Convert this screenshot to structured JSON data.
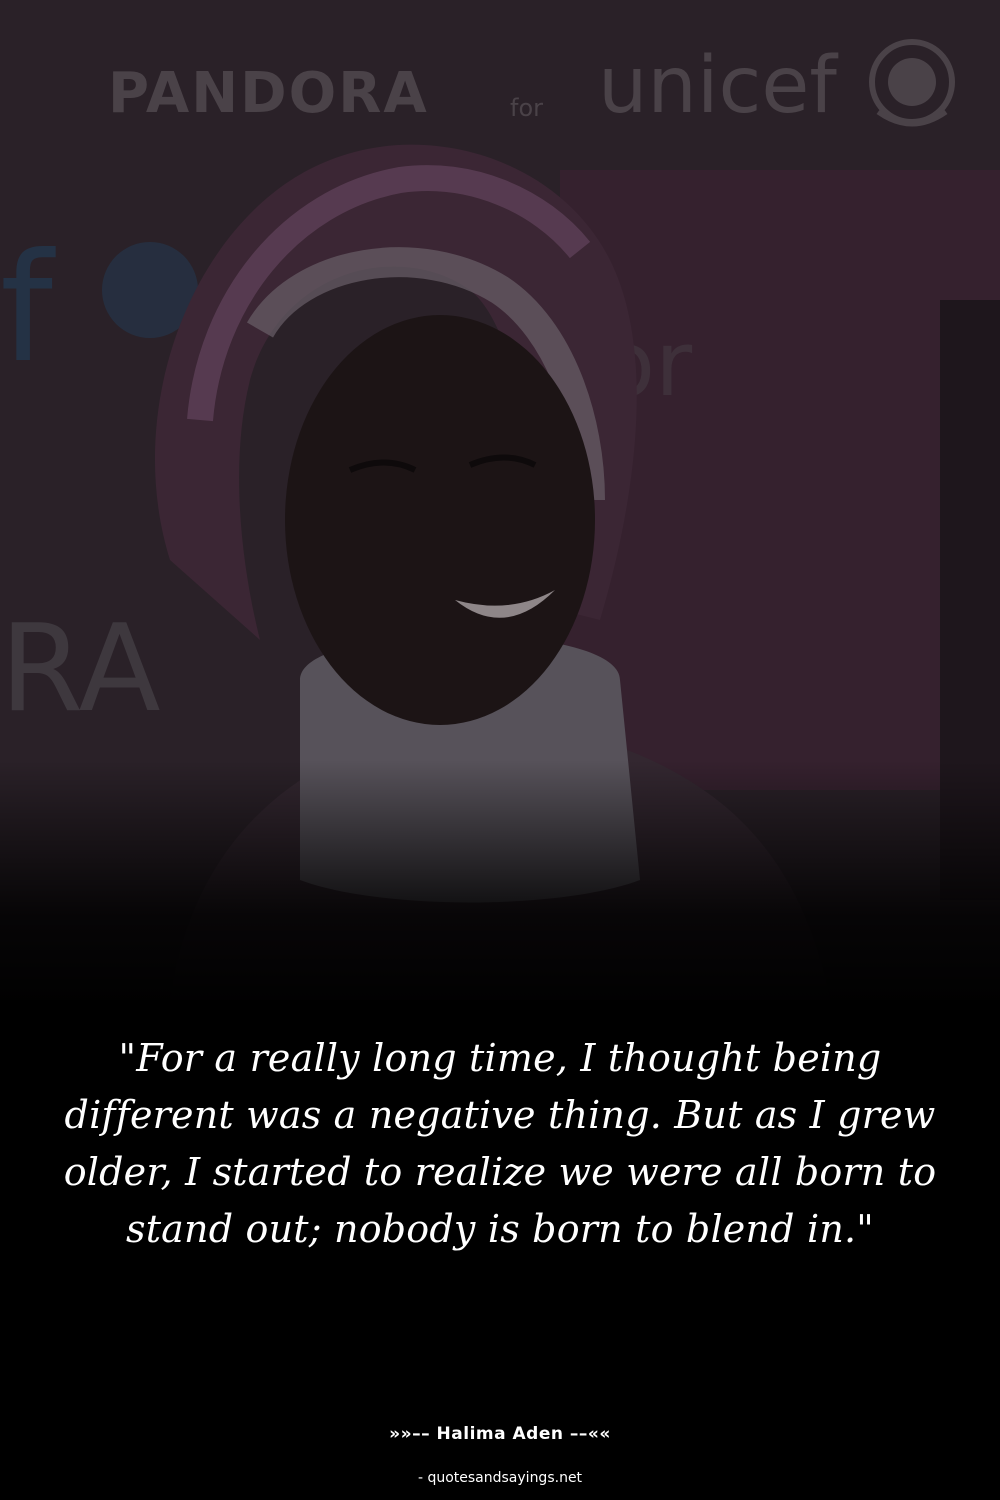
{
  "photo": {
    "backdrop_logos": {
      "brand": "PANDORA",
      "connector": "for",
      "partner": "unicef",
      "partial_left_top": "f",
      "partial_left_bottom": "RA",
      "partial_right": "or"
    },
    "icons": [
      "unicef-emblem-icon"
    ]
  },
  "quote": {
    "text": "\"For a really long time, I thought being different was a negative thing. But as I grew older, I started to realize we were all born to stand out; nobody is born to blend in.\""
  },
  "attribution": {
    "author": "»»–– Halima Aden ––««",
    "source": "- quotesandsayings.net"
  },
  "colors": {
    "background": "#000000",
    "text": "#ffffff",
    "photo_tint": "#2a2128"
  }
}
